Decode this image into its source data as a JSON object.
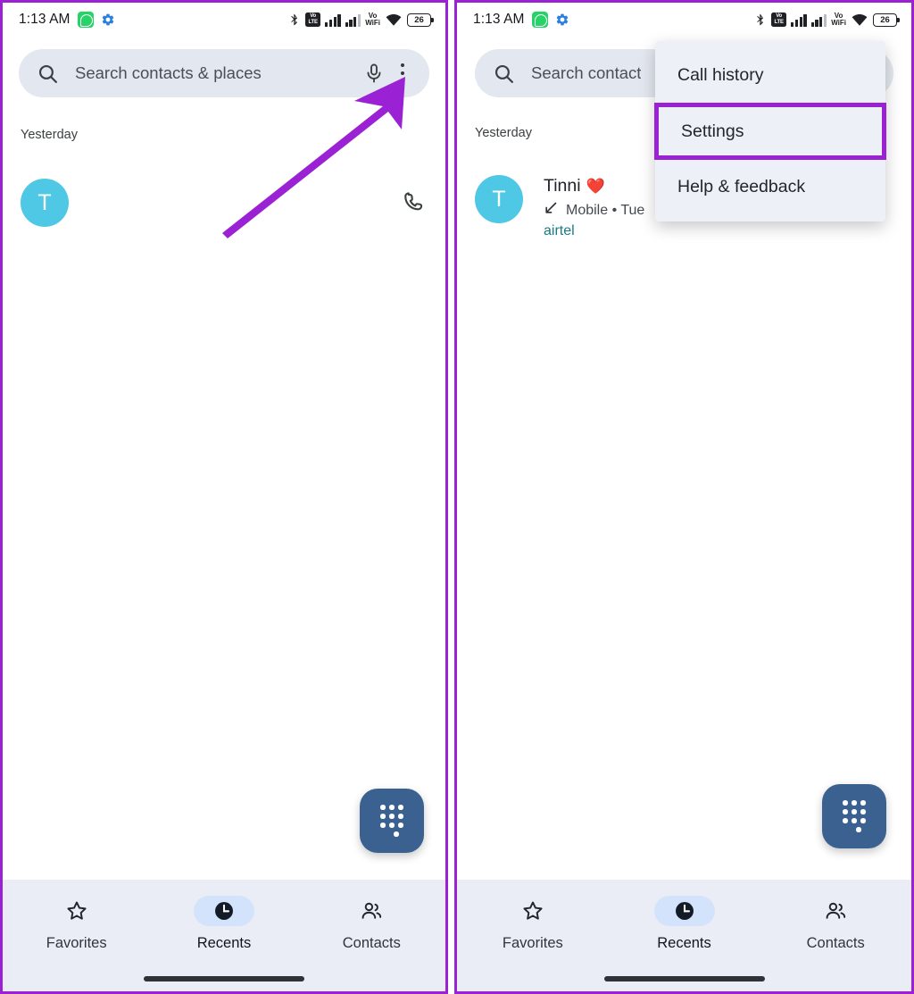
{
  "status_bar": {
    "time": "1:13 AM",
    "left_icons": [
      "whatsapp-icon",
      "gear-icon"
    ],
    "right_icons": [
      "bluetooth-icon",
      "volte-icon",
      "signal-bars-sim1",
      "signal-bars-sim2",
      "vowifi-icon",
      "wifi-icon",
      "battery-icon"
    ],
    "volte_top": "Vo",
    "volte_bottom": "LTE",
    "vowifi_top": "Vo",
    "vowifi_bottom": "WiFi",
    "battery_level": "26"
  },
  "search": {
    "placeholder_full": "Search contacts & places",
    "placeholder_truncated": "Search contact",
    "icons": [
      "search-icon",
      "mic-icon",
      "overflow-menu-icon"
    ]
  },
  "list": {
    "section_label": "Yesterday",
    "entry": {
      "avatar_initial": "T",
      "avatar_color": "#4ec8e4",
      "name": "Tinni",
      "name_emoji": "❤️",
      "direction_icon": "incoming-call-arrow",
      "subtitle": "Mobile • Tue",
      "carrier": "airtel",
      "carrier_color": "#1a7c82",
      "action_icon": "call-back-icon"
    }
  },
  "fab": {
    "name": "dialpad-button",
    "color": "#3b6190"
  },
  "bottom_nav": {
    "items": [
      {
        "label": "Favorites",
        "icon": "star-icon",
        "active": false
      },
      {
        "label": "Recents",
        "icon": "clock-icon",
        "active": true
      },
      {
        "label": "Contacts",
        "icon": "people-icon",
        "active": false
      }
    ],
    "active_pill_color": "#d3e3fb",
    "bar_color": "#eaedf5"
  },
  "overflow_menu": {
    "items": [
      {
        "label": "Call history",
        "highlighted": false
      },
      {
        "label": "Settings",
        "highlighted": true
      },
      {
        "label": "Help & feedback",
        "highlighted": false
      }
    ],
    "background": "#eef0f7",
    "highlight_color": "#9b21d4"
  },
  "annotation": {
    "arrow_color": "#9b21d4",
    "panel_border_color": "#9b21d4"
  }
}
